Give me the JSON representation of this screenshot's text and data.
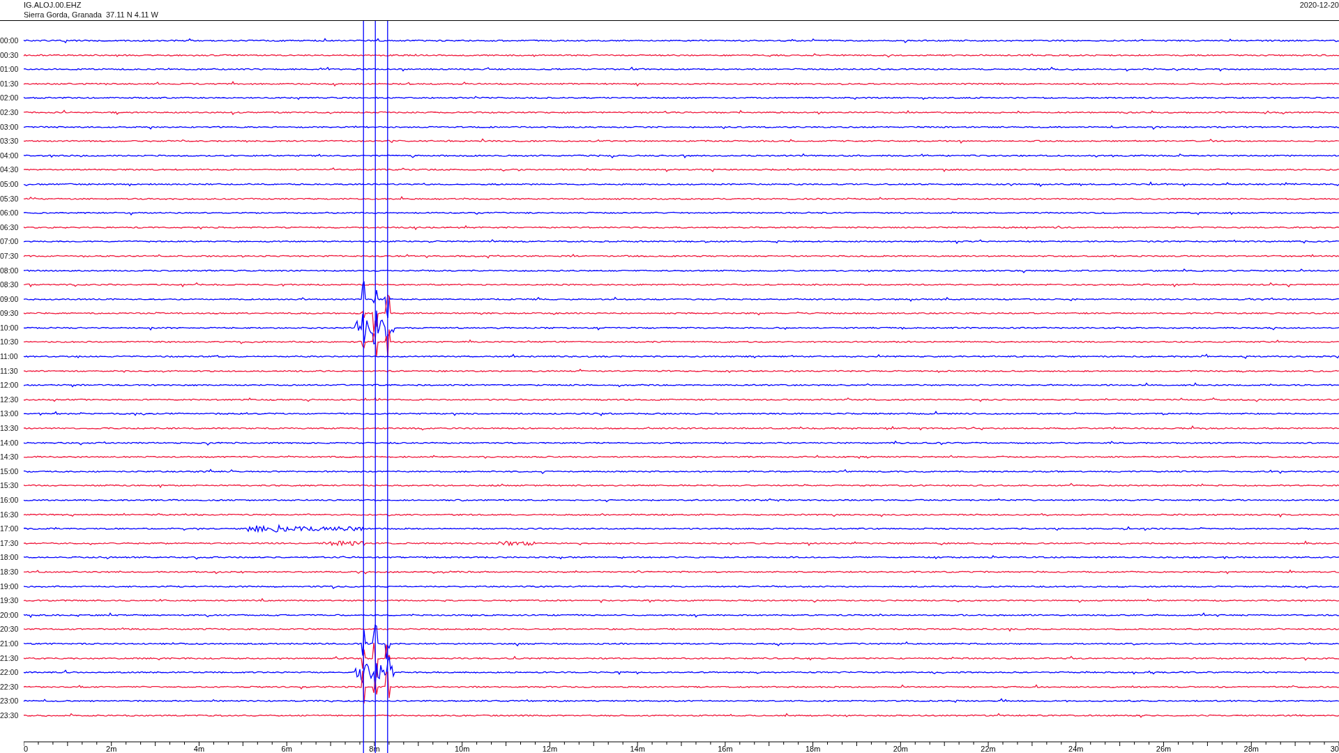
{
  "header": {
    "station": "IG.ALOJ.00.EHZ",
    "location": "Sierra Gorda, Granada  37.11 N 4.11 W",
    "date": "2020-12-20"
  },
  "rows": [
    {
      "time": "00:00",
      "color": "#0000ff"
    },
    {
      "time": "00:30",
      "color": "#f0183c"
    },
    {
      "time": "01:00",
      "color": "#0000ff"
    },
    {
      "time": "01:30",
      "color": "#f0183c"
    },
    {
      "time": "02:00",
      "color": "#0000ff"
    },
    {
      "time": "02:30",
      "color": "#f0183c"
    },
    {
      "time": "03:00",
      "color": "#0000ff"
    },
    {
      "time": "03:30",
      "color": "#f0183c"
    },
    {
      "time": "04:00",
      "color": "#0000ff"
    },
    {
      "time": "04:30",
      "color": "#f0183c"
    },
    {
      "time": "05:00",
      "color": "#0000ff"
    },
    {
      "time": "05:30",
      "color": "#f0183c"
    },
    {
      "time": "06:00",
      "color": "#0000ff"
    },
    {
      "time": "06:30",
      "color": "#f0183c"
    },
    {
      "time": "07:00",
      "color": "#0000ff"
    },
    {
      "time": "07:30",
      "color": "#f0183c"
    },
    {
      "time": "08:00",
      "color": "#0000ff"
    },
    {
      "time": "08:30",
      "color": "#f0183c"
    },
    {
      "time": "09:00",
      "color": "#0000ff"
    },
    {
      "time": "09:30",
      "color": "#f0183c"
    },
    {
      "time": "10:00",
      "color": "#0000ff"
    },
    {
      "time": "10:30",
      "color": "#f0183c"
    },
    {
      "time": "11:00",
      "color": "#0000ff"
    },
    {
      "time": "11:30",
      "color": "#f0183c"
    },
    {
      "time": "12:00",
      "color": "#0000ff"
    },
    {
      "time": "12:30",
      "color": "#f0183c"
    },
    {
      "time": "13:00",
      "color": "#0000ff"
    },
    {
      "time": "13:30",
      "color": "#f0183c"
    },
    {
      "time": "14:00",
      "color": "#0000ff"
    },
    {
      "time": "14:30",
      "color": "#f0183c"
    },
    {
      "time": "15:00",
      "color": "#0000ff"
    },
    {
      "time": "15:30",
      "color": "#f0183c"
    },
    {
      "time": "16:00",
      "color": "#0000ff"
    },
    {
      "time": "16:30",
      "color": "#f0183c"
    },
    {
      "time": "17:00",
      "color": "#0000ff"
    },
    {
      "time": "17:30",
      "color": "#f0183c"
    },
    {
      "time": "18:00",
      "color": "#0000ff"
    },
    {
      "time": "18:30",
      "color": "#f0183c"
    },
    {
      "time": "19:00",
      "color": "#0000ff"
    },
    {
      "time": "19:30",
      "color": "#f0183c"
    },
    {
      "time": "20:00",
      "color": "#0000ff"
    },
    {
      "time": "20:30",
      "color": "#f0183c"
    },
    {
      "time": "21:00",
      "color": "#0000ff"
    },
    {
      "time": "21:30",
      "color": "#f0183c"
    },
    {
      "time": "22:00",
      "color": "#0000ff"
    },
    {
      "time": "22:30",
      "color": "#f0183c"
    },
    {
      "time": "23:00",
      "color": "#0000ff"
    },
    {
      "time": "23:30",
      "color": "#f0183c"
    }
  ],
  "x_axis": {
    "tick_labels": [
      "0",
      "2m",
      "4m",
      "6m",
      "8m",
      "10m",
      "12m",
      "14m",
      "16m",
      "18m",
      "20m",
      "22m",
      "24m",
      "26m",
      "28m",
      "30"
    ]
  }
}
